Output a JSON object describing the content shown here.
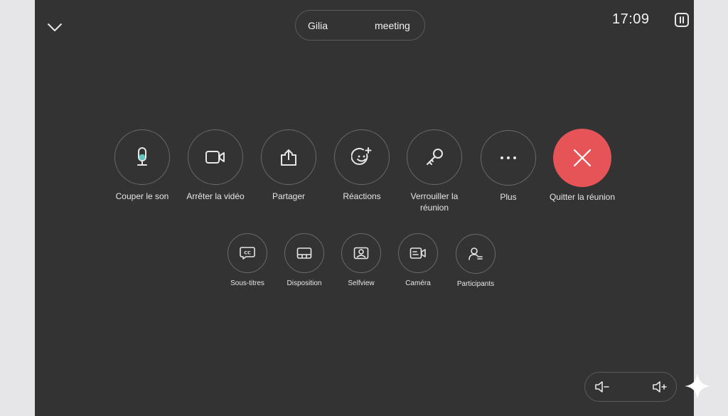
{
  "header": {
    "title_part1": "Gilia",
    "title_part2": "meeting",
    "clock": "17:09"
  },
  "controls": [
    {
      "label": "Couper le son",
      "icon": "microphone-icon"
    },
    {
      "label": "Arrêter la vidéo",
      "icon": "video-camera-icon"
    },
    {
      "label": "Partager",
      "icon": "share-icon"
    },
    {
      "label": "Réactions",
      "icon": "emoji-add-icon"
    },
    {
      "label": "Verrouiller la réunion",
      "icon": "key-icon"
    },
    {
      "label": "Plus",
      "icon": "more-dots-icon"
    },
    {
      "label": "Quitter la réunion",
      "icon": "close-icon"
    }
  ],
  "secondary_controls": [
    {
      "label": "Sous-titres",
      "icon": "closed-captions-icon"
    },
    {
      "label": "Disposition",
      "icon": "layout-icon"
    },
    {
      "label": "Selfview",
      "icon": "selfview-icon"
    },
    {
      "label": "Caméra",
      "icon": "camera-settings-icon"
    },
    {
      "label": "Participants",
      "icon": "participants-icon"
    }
  ],
  "colors": {
    "panel": "#333333",
    "leave_red": "#e75458",
    "mic_accent": "#5fc5c0"
  }
}
